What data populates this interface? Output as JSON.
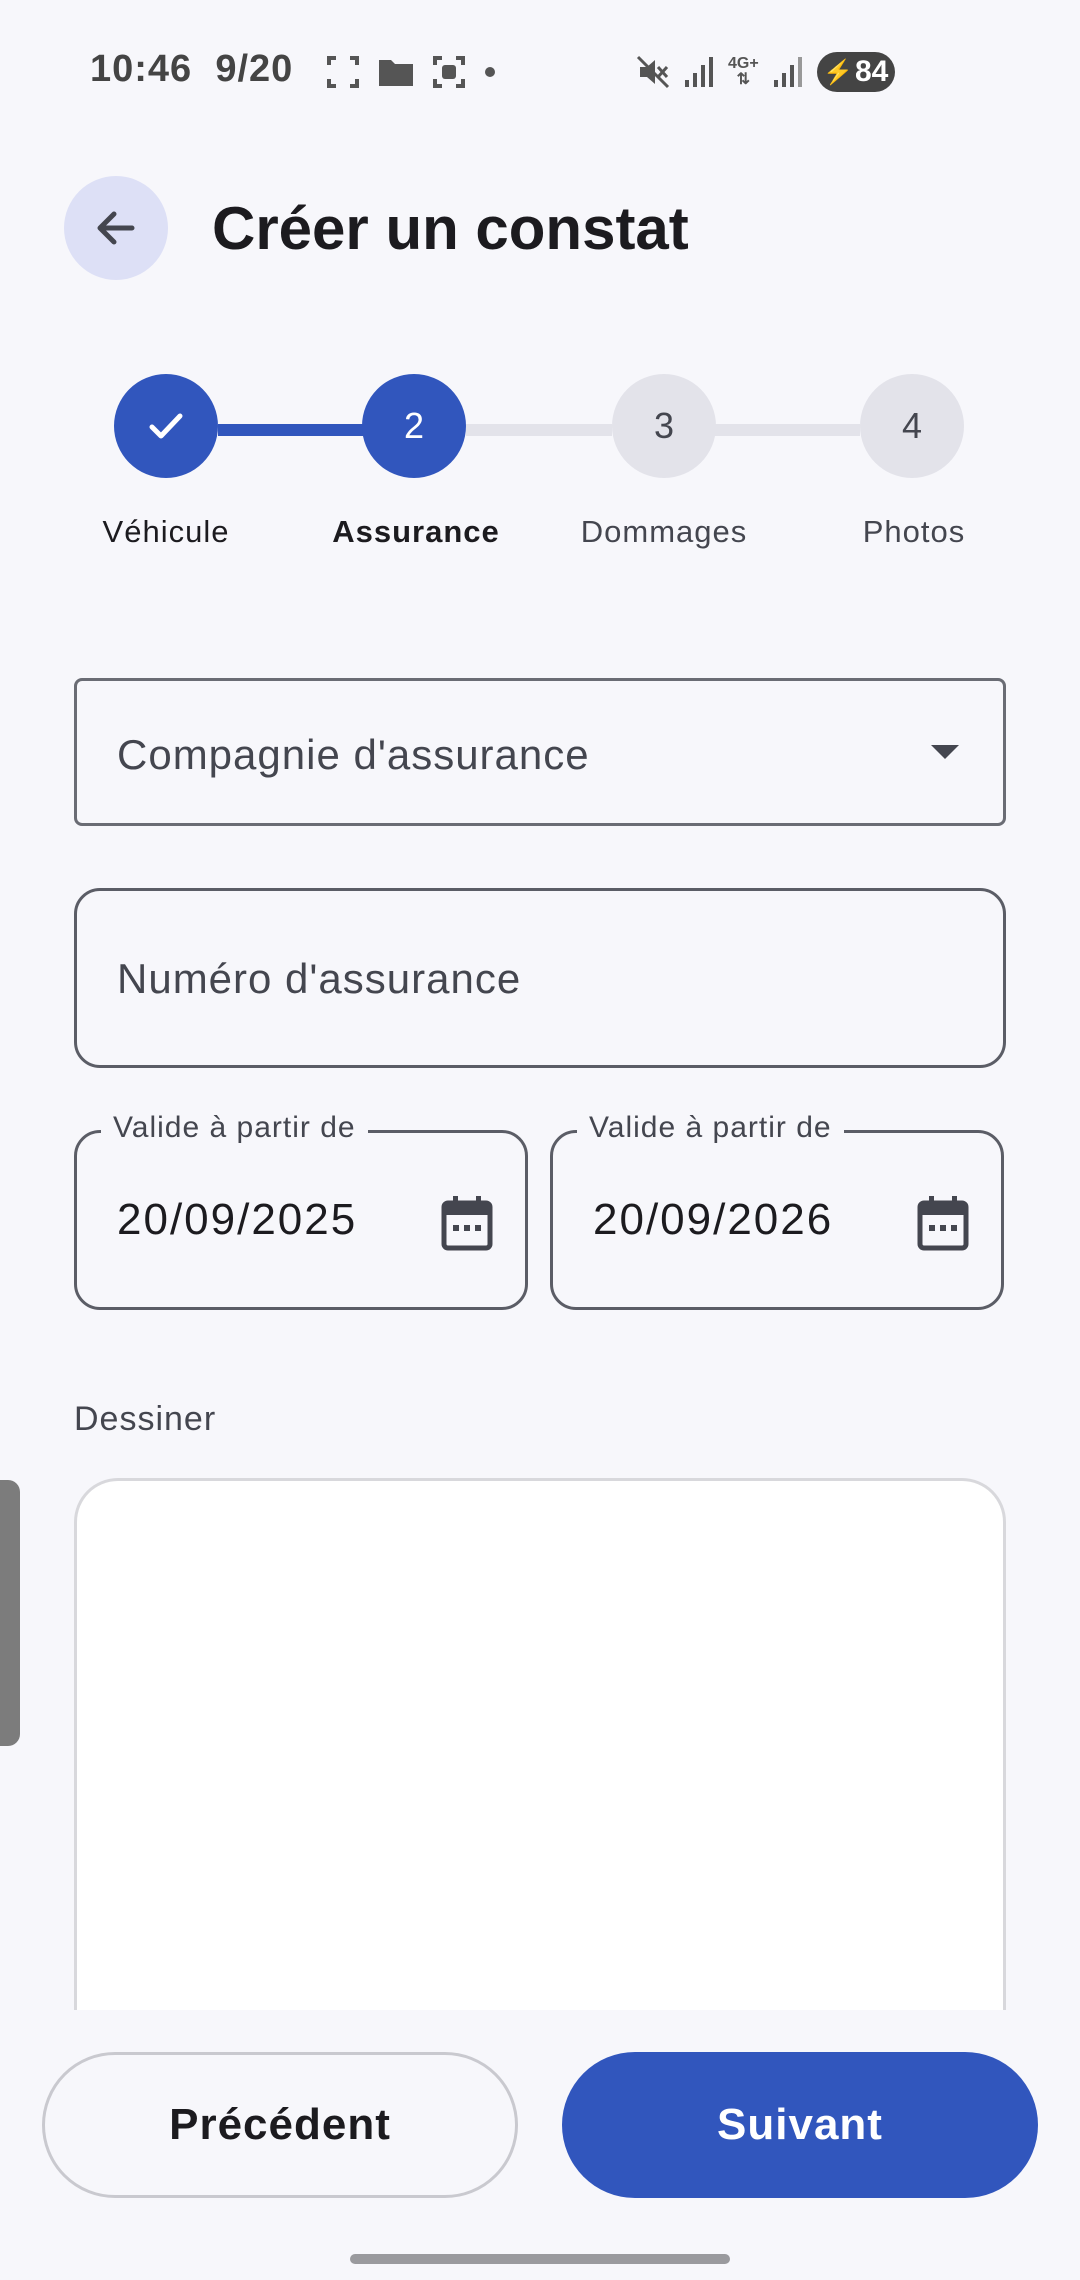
{
  "status_bar": {
    "time": "10:46",
    "date": "9/20",
    "network": "4G+",
    "battery": "84"
  },
  "header": {
    "title": "Créer un constat"
  },
  "stepper": {
    "steps": [
      {
        "number": "1",
        "label": "Véhicule",
        "state": "completed"
      },
      {
        "number": "2",
        "label": "Assurance",
        "state": "current"
      },
      {
        "number": "3",
        "label": "Dommages",
        "state": "pending"
      },
      {
        "number": "4",
        "label": "Photos",
        "state": "pending"
      }
    ]
  },
  "form": {
    "company_placeholder": "Compagnie d'assurance",
    "number_placeholder": "Numéro d'assurance",
    "valid_from": {
      "label": "Valide à partir de",
      "value": "20/09/2025"
    },
    "valid_until": {
      "label": "Valide à partir de",
      "value": "20/09/2026"
    },
    "draw_label": "Dessiner"
  },
  "footer": {
    "prev_label": "Précédent",
    "next_label": "Suivant"
  },
  "colors": {
    "primary": "#3156bd",
    "back_button_bg": "#dde0f6",
    "background": "#f7f7fb"
  }
}
